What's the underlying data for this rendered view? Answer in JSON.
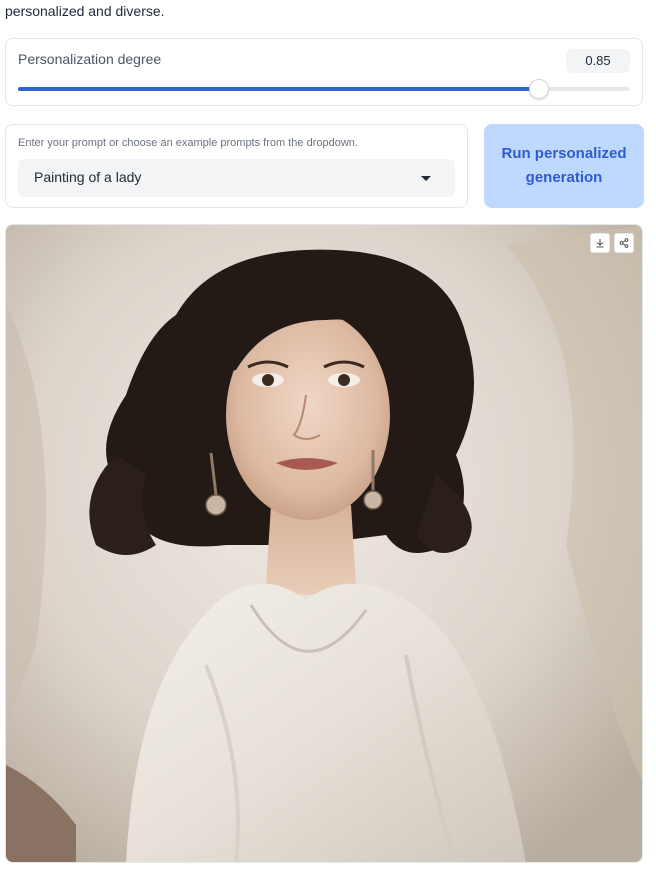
{
  "intro": {
    "text": "personalized and diverse."
  },
  "slider": {
    "label": "Personalization degree",
    "value": "0.85",
    "fraction": 0.85
  },
  "prompt": {
    "label": "Enter your prompt or choose an example prompts from the dropdown.",
    "selected": "Painting of a lady"
  },
  "run_button": {
    "label": "Run personalized generation"
  },
  "output_image": {
    "icons": [
      "download-icon",
      "share-icon"
    ]
  }
}
